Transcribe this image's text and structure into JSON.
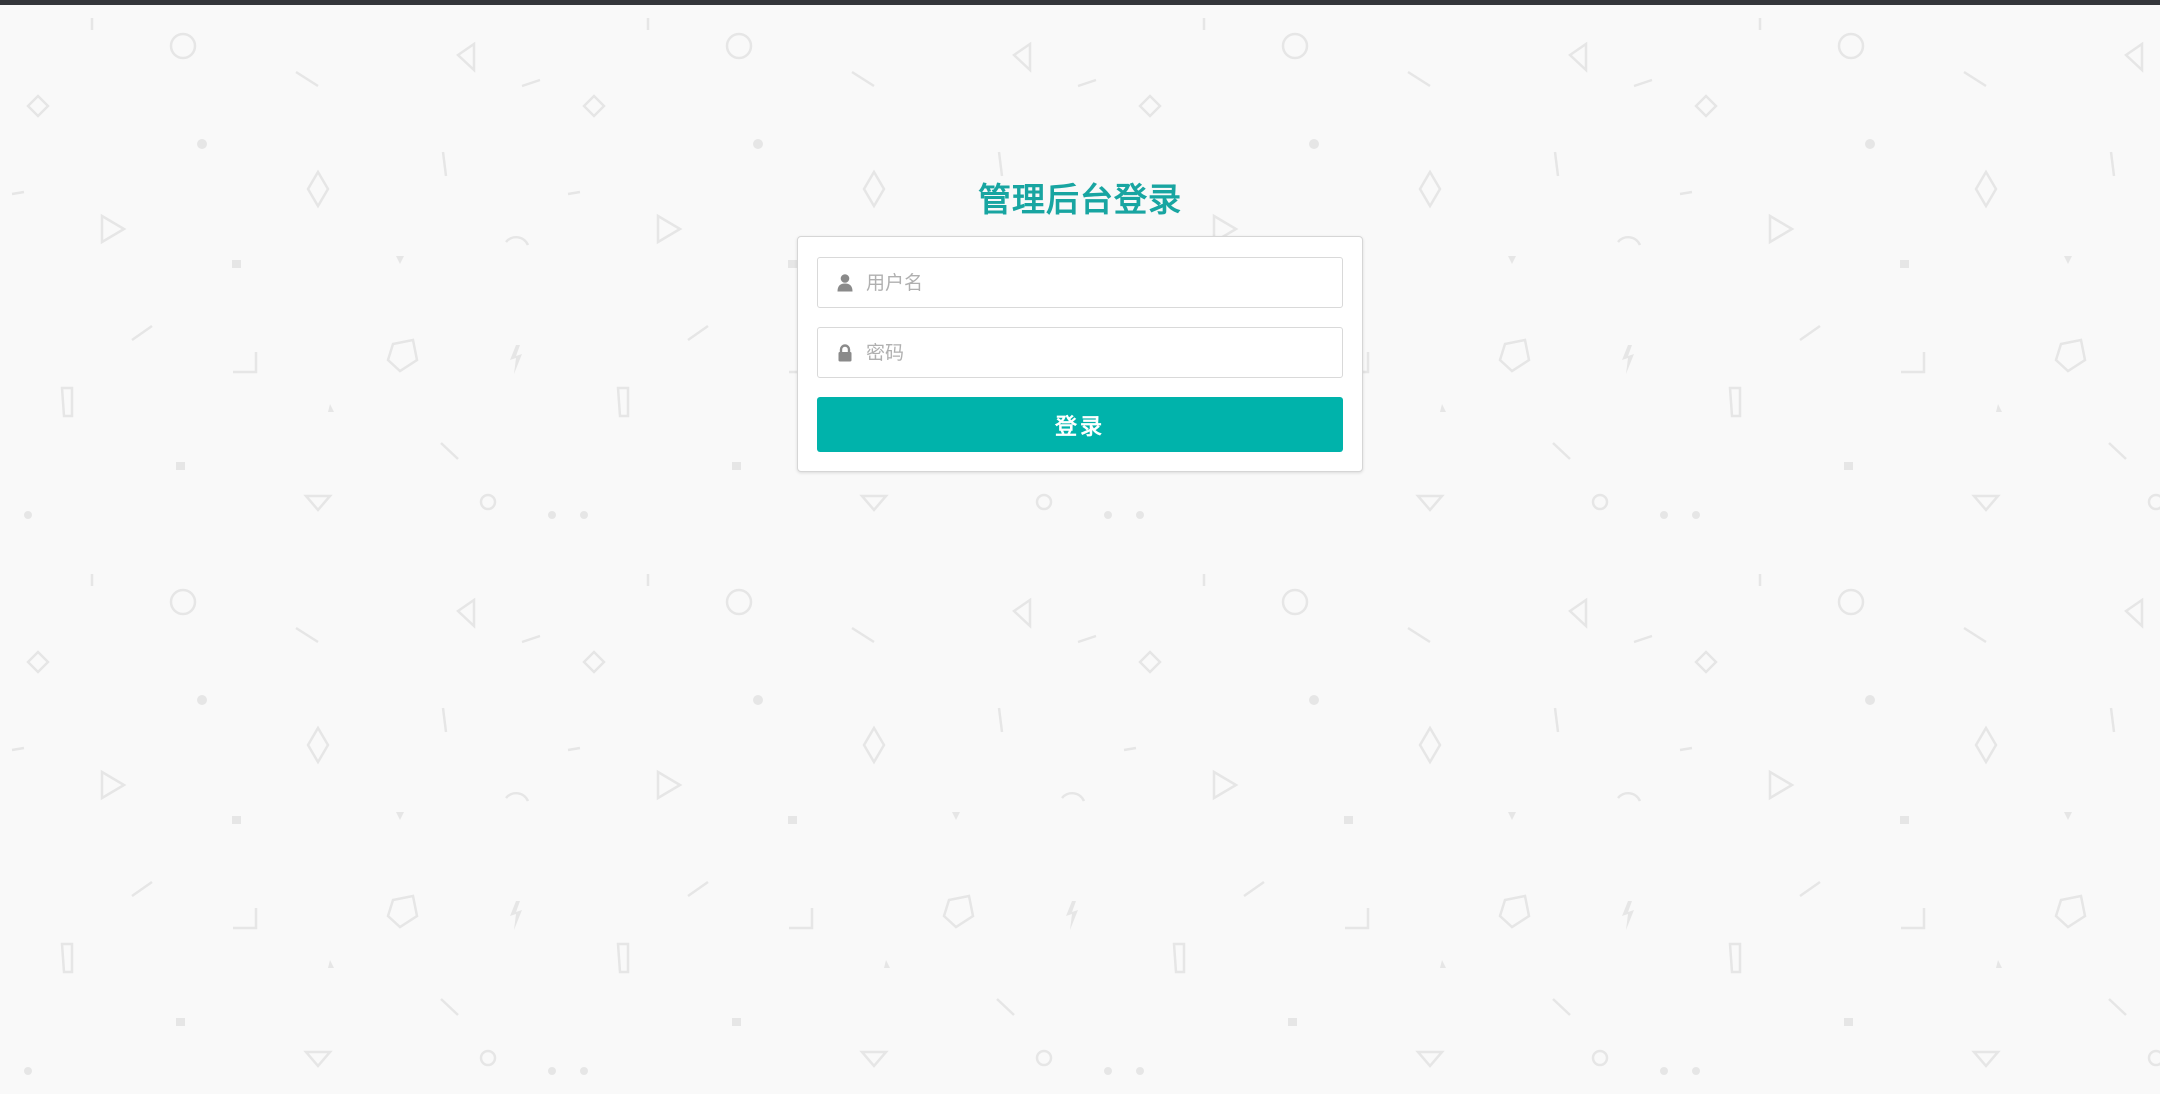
{
  "login": {
    "title": "管理后台登录",
    "username_placeholder": "用户名",
    "password_placeholder": "密码",
    "submit_label": "登录"
  },
  "colors": {
    "accent": "#00b3ab",
    "title": "#18a5a1",
    "top_bar": "#34363b",
    "background": "#f9f9f9"
  },
  "icons": {
    "username": "user-icon",
    "password": "lock-icon"
  }
}
